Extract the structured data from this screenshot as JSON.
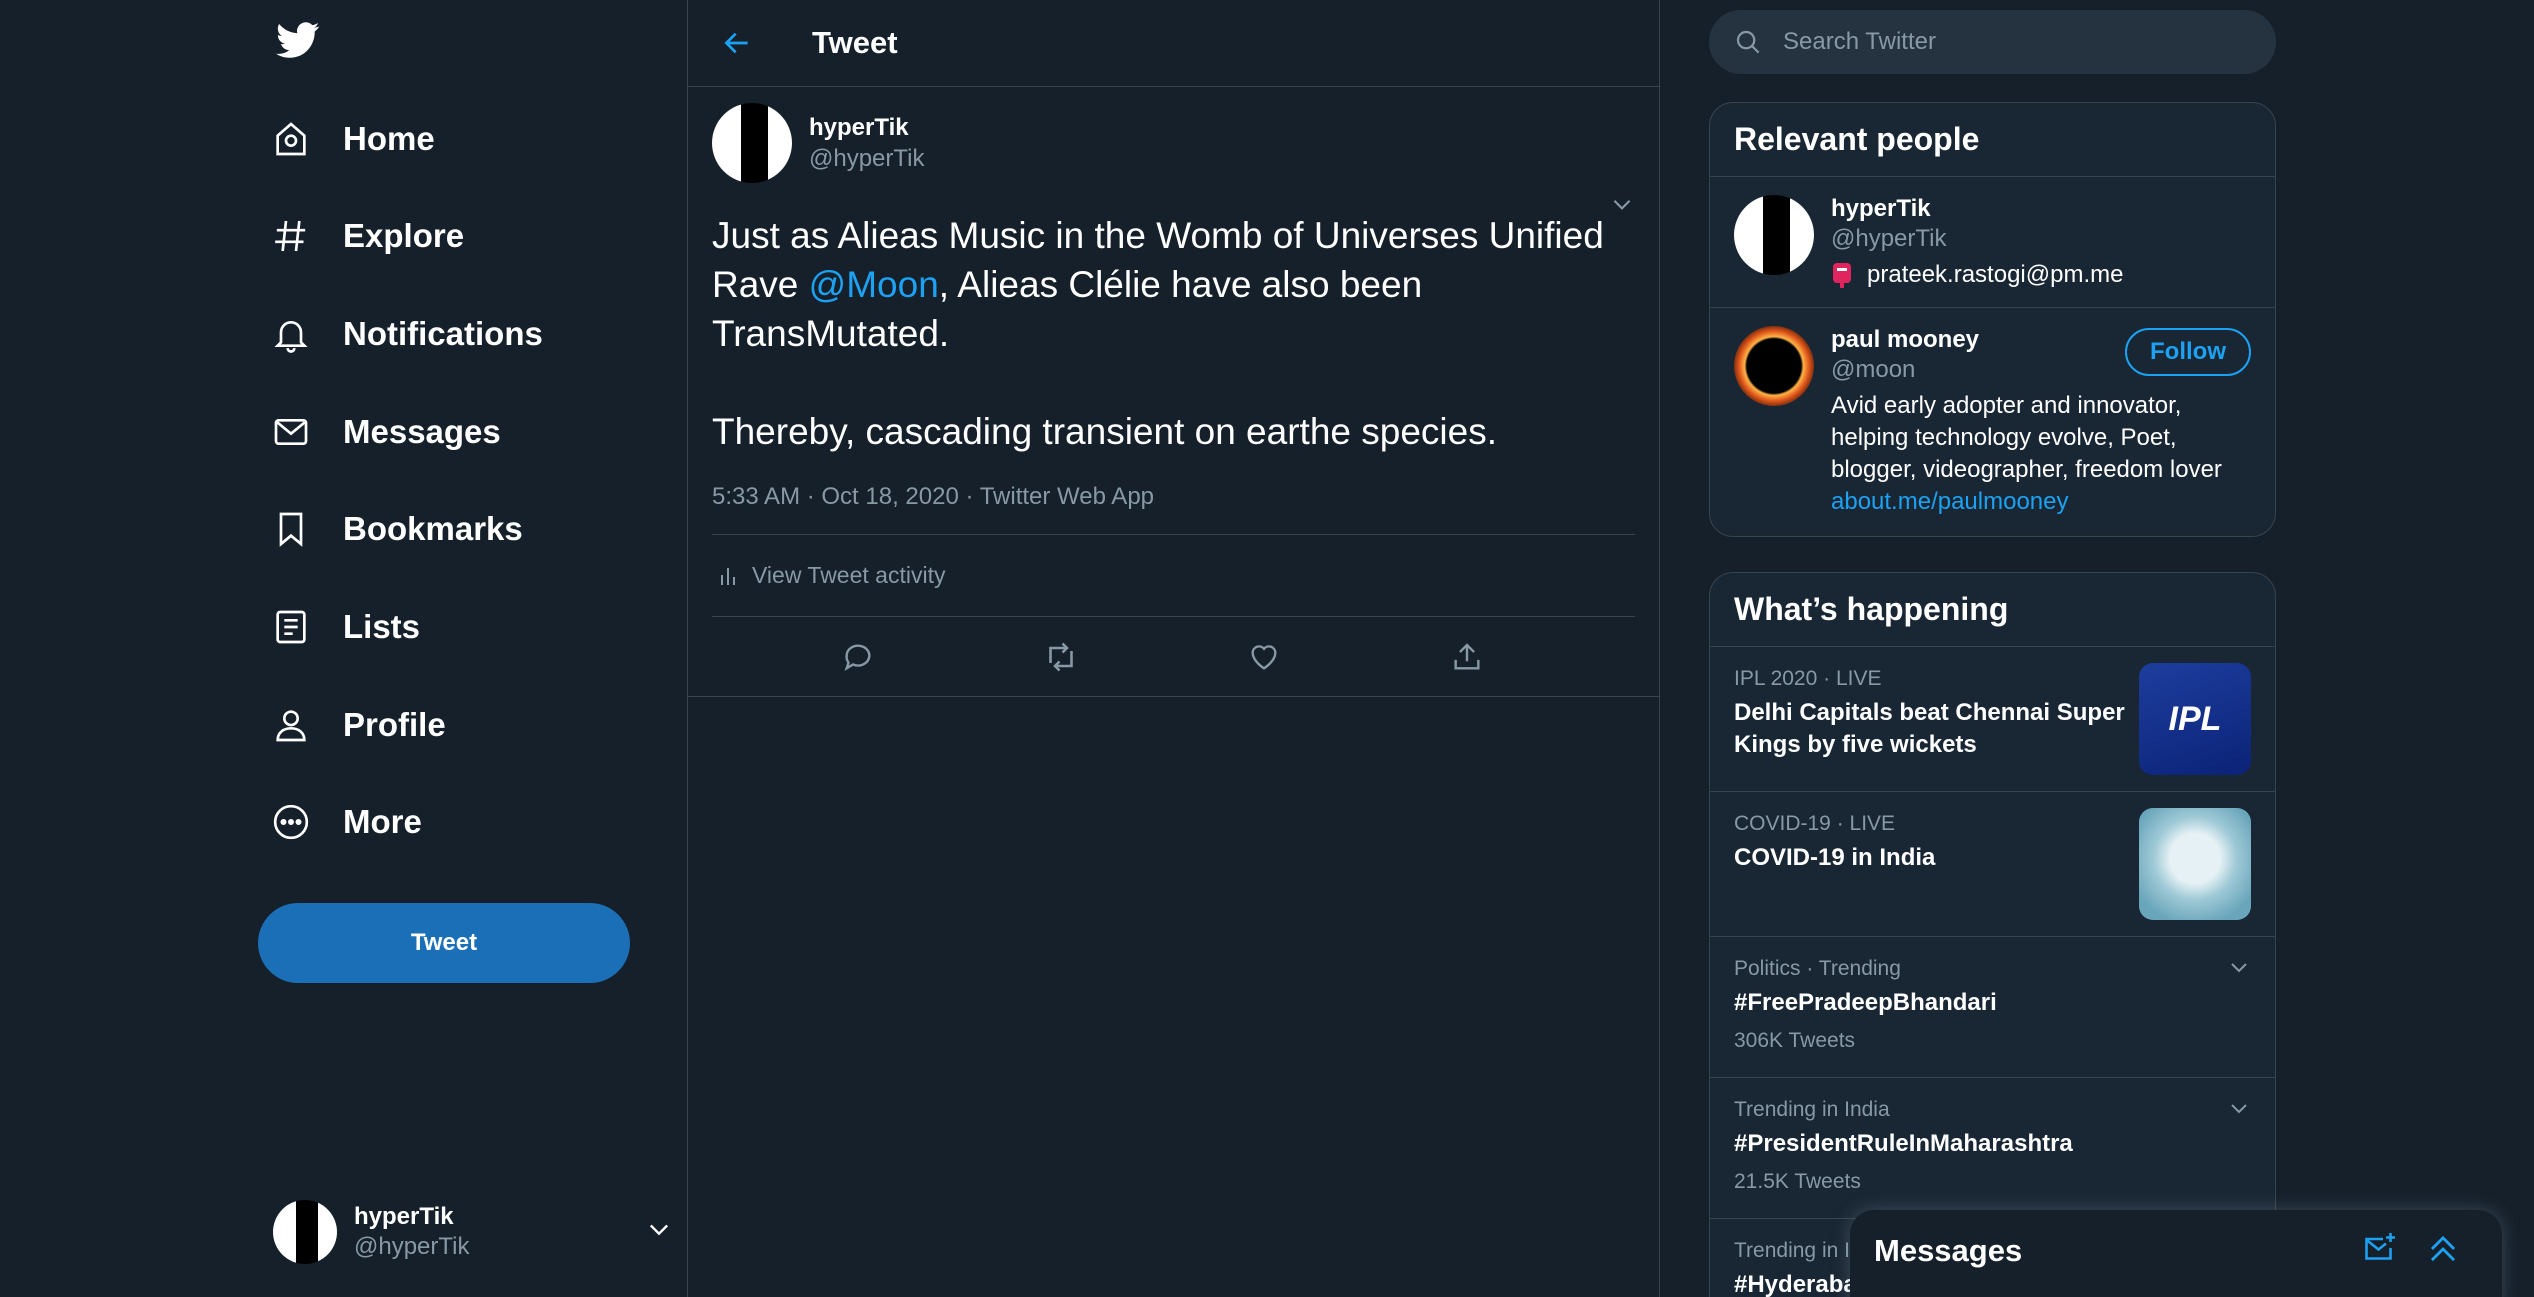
{
  "colors": {
    "background": "#15202b",
    "accent": "#1da1f2",
    "tweet_button": "#1a6fb6",
    "muted_text": "#8899a6",
    "border": "#38444d",
    "panel": "#192734"
  },
  "sidebar": {
    "logo_icon": "twitter-bird-icon",
    "nav": [
      {
        "label": "Home",
        "icon": "home-icon"
      },
      {
        "label": "Explore",
        "icon": "hashtag-icon"
      },
      {
        "label": "Notifications",
        "icon": "bell-icon"
      },
      {
        "label": "Messages",
        "icon": "envelope-icon"
      },
      {
        "label": "Bookmarks",
        "icon": "bookmark-icon"
      },
      {
        "label": "Lists",
        "icon": "list-icon"
      },
      {
        "label": "Profile",
        "icon": "person-icon"
      },
      {
        "label": "More",
        "icon": "more-circle-icon"
      }
    ],
    "tweet_button": "Tweet",
    "account": {
      "name": "hyperTik",
      "handle": "@hyperTik"
    }
  },
  "main": {
    "title": "Tweet",
    "tweet": {
      "author": {
        "name": "hyperTik",
        "handle": "@hyperTik"
      },
      "body": {
        "line1_pre": "Just as Alieas Music in the Womb of Universes Unified Rave ",
        "mention": "@Moon",
        "line1_post": ", Alieas Clélie have also been TransMutated.",
        "line2": "Thereby, cascading transient on earthe species."
      },
      "meta": "5:33 AM · Oct 18, 2020 · Twitter Web App",
      "activity": "View Tweet activity"
    }
  },
  "right": {
    "search_placeholder": "Search Twitter",
    "relevant_people": {
      "title": "Relevant people",
      "people": [
        {
          "name": "hyperTik",
          "handle": "@hyperTik",
          "email": "prateek.rastogi@pm.me"
        },
        {
          "name": "paul mooney",
          "handle": "@moon",
          "follow_label": "Follow",
          "bio": "Avid early adopter and innovator, helping technology evolve, Poet, blogger, videographer, freedom lover",
          "link": "about.me/paulmooney"
        }
      ]
    },
    "whats_happening": {
      "title": "What’s happening",
      "trends": [
        {
          "meta": "IPL 2020 · LIVE",
          "title": "Delhi Capitals beat Chennai Super Kings by five wickets",
          "thumb_label": "IPL"
        },
        {
          "meta": "COVID-19 · LIVE",
          "title": "COVID-19 in India"
        },
        {
          "meta": "Politics · Trending",
          "title": "#FreePradeepBhandari",
          "count": "306K Tweets"
        },
        {
          "meta": "Trending in India",
          "title": "#PresidentRuleInMaharashtra",
          "count": "21.5K Tweets"
        },
        {
          "meta": "Trending in I",
          "title": "#Hyderaba"
        }
      ]
    }
  },
  "messages_drawer": {
    "title": "Messages"
  }
}
